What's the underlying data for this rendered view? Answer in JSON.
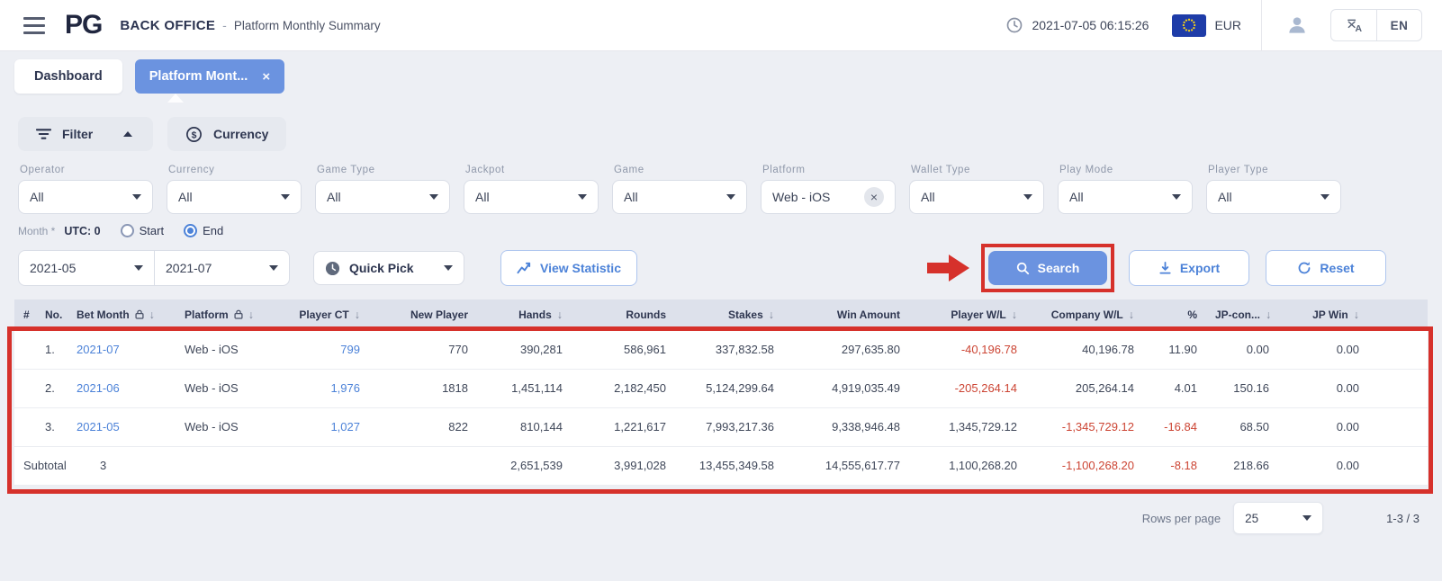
{
  "topbar": {
    "brand": "PG",
    "app_title": "BACK OFFICE",
    "separator": "-",
    "page_title": "Platform Monthly Summary",
    "datetime": "2021-07-05 06:15:26",
    "currency": "EUR",
    "language": "EN"
  },
  "tabs": {
    "dashboard": "Dashboard",
    "active_tab": "Platform Mont..."
  },
  "filter_panel": {
    "filter_button": "Filter",
    "currency_button": "Currency"
  },
  "filters": [
    {
      "key": "operator",
      "label": "Operator",
      "value": "All"
    },
    {
      "key": "currency",
      "label": "Currency",
      "value": "All"
    },
    {
      "key": "game-type",
      "label": "Game Type",
      "value": "All"
    },
    {
      "key": "jackpot",
      "label": "Jackpot",
      "value": "All"
    },
    {
      "key": "game",
      "label": "Game",
      "value": "All"
    },
    {
      "key": "platform",
      "label": "Platform",
      "value": "Web - iOS",
      "clearable": true
    },
    {
      "key": "wallet-type",
      "label": "Wallet Type",
      "value": "All"
    },
    {
      "key": "play-mode",
      "label": "Play Mode",
      "value": "All"
    },
    {
      "key": "player-type",
      "label": "Player Type",
      "value": "All"
    }
  ],
  "month_filter": {
    "label": "Month *",
    "utc_label": "UTC: 0",
    "start_label": "Start",
    "end_label": "End",
    "selected": "End",
    "from": "2021-05",
    "to": "2021-07",
    "quick_pick": "Quick Pick",
    "view_statistic": "View Statistic"
  },
  "actions": {
    "search": "Search",
    "export": "Export",
    "reset": "Reset"
  },
  "table": {
    "columns": [
      {
        "key": "idx",
        "label": "#",
        "align": "left"
      },
      {
        "key": "no",
        "label": "No.",
        "align": "left"
      },
      {
        "key": "bet_month",
        "label": "Bet Month",
        "align": "left",
        "lock": true,
        "sort": true,
        "link": true
      },
      {
        "key": "platform",
        "label": "Platform",
        "align": "left",
        "lock": true,
        "sort": true
      },
      {
        "key": "player_ct",
        "label": "Player CT",
        "align": "right",
        "sort": true,
        "link": true
      },
      {
        "key": "new_player",
        "label": "New Player",
        "align": "right"
      },
      {
        "key": "hands",
        "label": "Hands",
        "align": "right",
        "sort": true
      },
      {
        "key": "rounds",
        "label": "Rounds",
        "align": "right"
      },
      {
        "key": "stakes",
        "label": "Stakes",
        "align": "right",
        "sort": true
      },
      {
        "key": "win_amount",
        "label": "Win Amount",
        "align": "right"
      },
      {
        "key": "player_wl",
        "label": "Player W/L",
        "align": "right",
        "sort": true
      },
      {
        "key": "company_wl",
        "label": "Company W/L",
        "align": "right",
        "sort": true
      },
      {
        "key": "pct",
        "label": "%",
        "align": "right"
      },
      {
        "key": "jp_con",
        "label": "JP-con...",
        "align": "right",
        "sort": true
      },
      {
        "key": "jp_win",
        "label": "JP Win",
        "align": "right",
        "sort": true
      }
    ],
    "rows": [
      {
        "no": "1.",
        "bet_month": "2021-07",
        "platform": "Web - iOS",
        "player_ct": "799",
        "new_player": "770",
        "hands": "390,281",
        "rounds": "586,961",
        "stakes": "337,832.58",
        "win_amount": "297,635.80",
        "player_wl": "-40,196.78",
        "company_wl": "40,196.78",
        "pct": "11.90",
        "jp_con": "0.00",
        "jp_win": "0.00"
      },
      {
        "no": "2.",
        "bet_month": "2021-06",
        "platform": "Web - iOS",
        "player_ct": "1,976",
        "new_player": "1818",
        "hands": "1,451,114",
        "rounds": "2,182,450",
        "stakes": "5,124,299.64",
        "win_amount": "4,919,035.49",
        "player_wl": "-205,264.14",
        "company_wl": "205,264.14",
        "pct": "4.01",
        "jp_con": "150.16",
        "jp_win": "0.00"
      },
      {
        "no": "3.",
        "bet_month": "2021-05",
        "platform": "Web - iOS",
        "player_ct": "1,027",
        "new_player": "822",
        "hands": "810,144",
        "rounds": "1,221,617",
        "stakes": "7,993,217.36",
        "win_amount": "9,338,946.48",
        "player_wl": "1,345,729.12",
        "company_wl": "-1,345,729.12",
        "pct": "-16.84",
        "jp_con": "68.50",
        "jp_win": "0.00"
      }
    ],
    "subtotal": {
      "label": "Subtotal",
      "bet_month": "3",
      "hands": "2,651,539",
      "rounds": "3,991,028",
      "stakes": "13,455,349.58",
      "win_amount": "14,555,617.77",
      "player_wl": "1,100,268.20",
      "company_wl": "-1,100,268.20",
      "pct": "-8.18",
      "jp_con": "218.66",
      "jp_win": "0.00"
    }
  },
  "pagination": {
    "rows_per_page_label": "Rows per page",
    "rows_per_page": "25",
    "range": "1-3 / 3"
  },
  "icons": {
    "sort_desc": "↓",
    "clear": "×",
    "close": "×"
  },
  "colors": {
    "accent_blue": "#6b93e0",
    "link_blue": "#4c82d8",
    "negative_red": "#cc4433",
    "annotation_red": "#d6312b"
  }
}
